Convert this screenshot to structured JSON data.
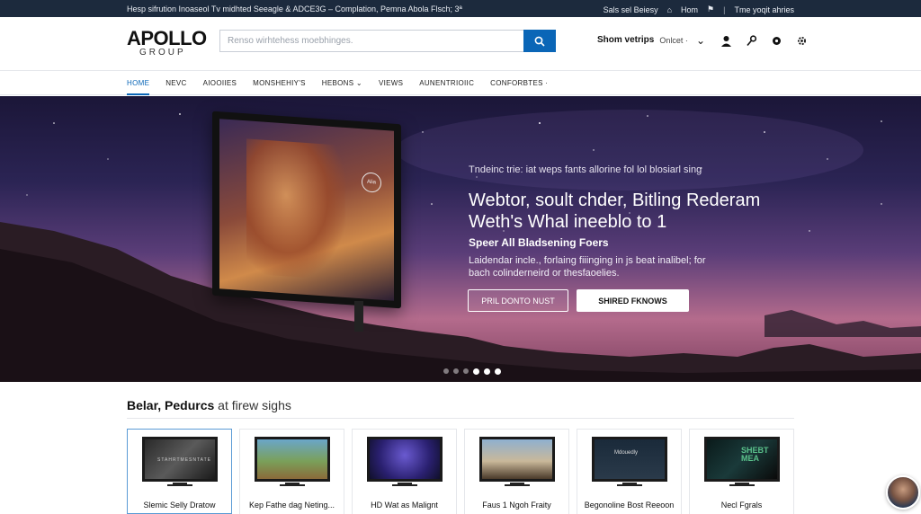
{
  "topbar": {
    "promo": "Hesp sifrution Inoaseol Tv midhted Seeagle & ADCE3G – Complation, Pemna Abola Flsch; 3ª",
    "link1": "Sals sel Beiesy",
    "link2": "Hom",
    "link3": "Tme yoqit ahries"
  },
  "header": {
    "logo_main": "APOLLO",
    "logo_sub": "GROUP",
    "search_placeholder": "Renso wirhtehess moebhinges.",
    "show_label": "Shom vetrips",
    "online_label": "Onlcet ·"
  },
  "nav": {
    "items": [
      "HOME",
      "NEVC",
      "AIOOIIES",
      "MONSHEHIY'S",
      "HEBONS",
      "VIEWS",
      "AUNENTRIOIIC",
      "CONFORBTES ·"
    ]
  },
  "hero": {
    "tv_brand": "Alia",
    "eyebrow": "Tndeinc trie: iat weps fants allorine fol lol blosiarl sing",
    "headline_1": "Webtor, soult chder, Bitling Rederam",
    "headline_2": "Weth's Whal ineeblo to 1",
    "subhead": "Speer All Bladsening Foers",
    "body": "Laidendar incle., forlaing fiiinging in js beat inalibel; for bach colinderneird or thesfaoelies.",
    "btn_outline": "PRIL DONTO NUST",
    "btn_solid": "SHIRED FKNOWS"
  },
  "products": {
    "title_bold": "Belar, Pedurcs",
    "title_light": "at firew sighs",
    "items": [
      {
        "name": "Slemic Selly Dratow",
        "thumb_text": "STAHRTMESNTATE"
      },
      {
        "name": "Kep Fathe dag Neting...",
        "thumb_text": ""
      },
      {
        "name": "HD Wat as Malignt",
        "thumb_text": ""
      },
      {
        "name": "Faus 1 Ngoh Fraity",
        "thumb_text": ""
      },
      {
        "name": "Begonoline Bost Reeoon",
        "thumb_text": "Mdouedly"
      },
      {
        "name": "Necl Fgrals",
        "thumb_text": "SHEBT MEA"
      }
    ]
  },
  "colors": {
    "accent": "#0a66b7",
    "topbar_bg": "#1c2a3d"
  }
}
